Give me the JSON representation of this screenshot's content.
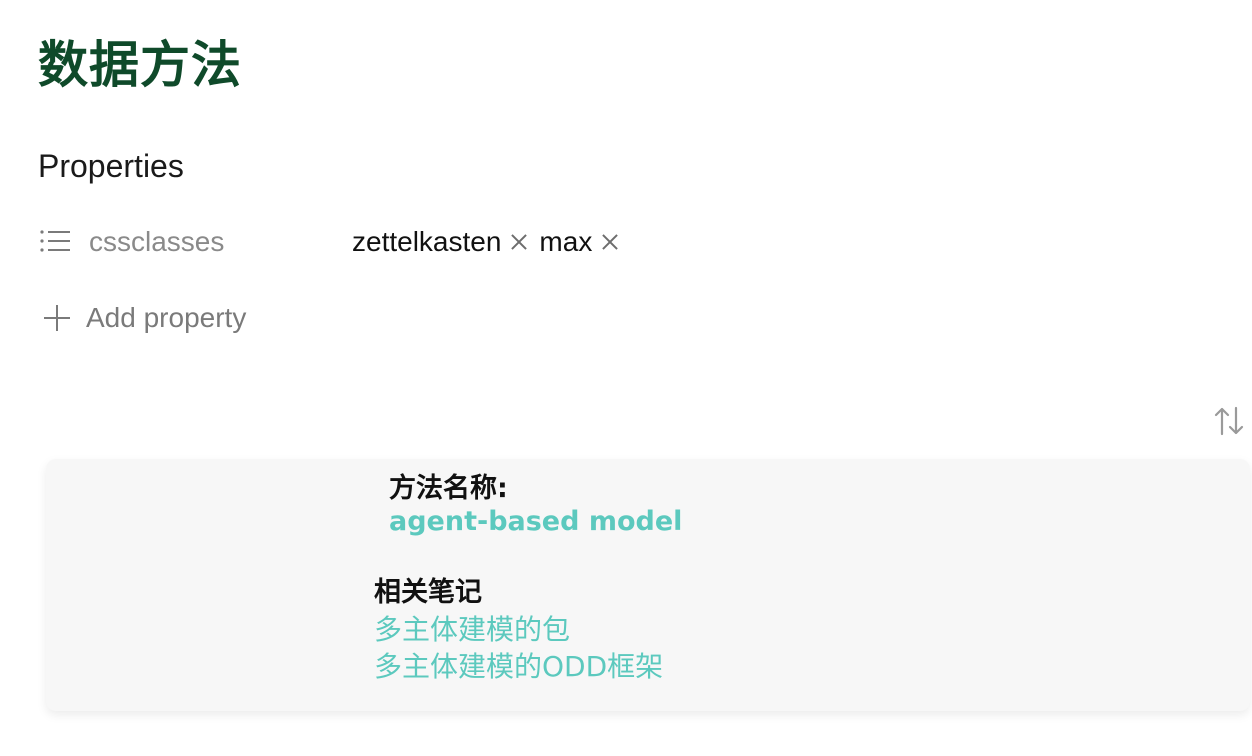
{
  "page": {
    "title": "数据方法"
  },
  "properties": {
    "heading": "Properties",
    "rows": [
      {
        "icon": "list-icon",
        "key": "cssclasses",
        "values": [
          "zettelkasten",
          "max"
        ]
      }
    ],
    "add_label": "Add property"
  },
  "sort": {
    "icon": "sort-arrows-icon"
  },
  "card": {
    "method_label": "方法名称:",
    "method_value": "agent-based model",
    "related_label": "相关笔记",
    "related_links": [
      "多主体建模的包",
      "多主体建模的ODD框架"
    ]
  },
  "colors": {
    "title": "#0f4a2a",
    "link": "#5cc9be",
    "card_bg": "#f7f7f7"
  }
}
